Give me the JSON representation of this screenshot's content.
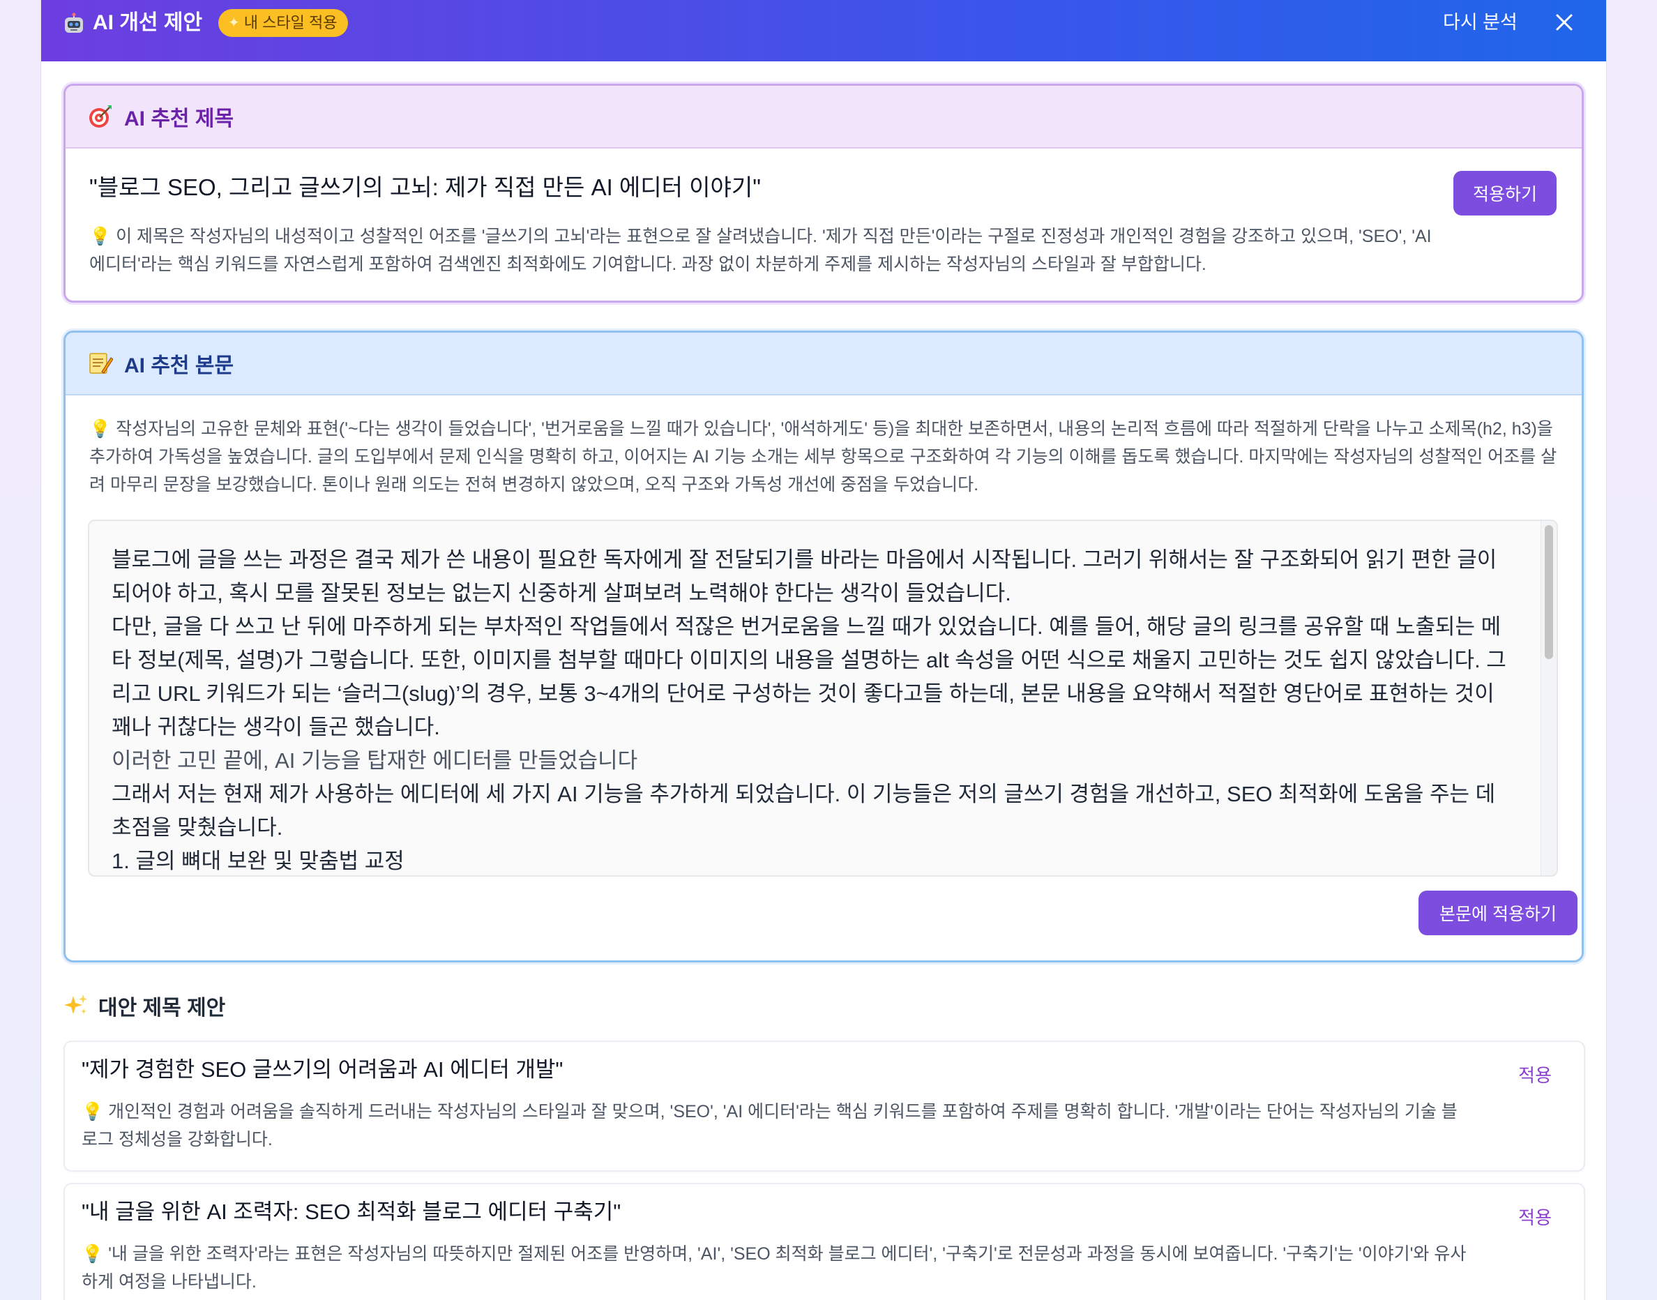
{
  "header": {
    "title": "AI 개선 제안",
    "badge": "내 스타일 적용",
    "reanalyze_label": "다시 분석",
    "icons": [
      "robot-icon",
      "sparkles-icon",
      "close-icon"
    ],
    "gradient": [
      "#6d3ee0",
      "#1f66ea"
    ]
  },
  "title_card": {
    "heading": "AI 추천 제목",
    "icon": "target-icon",
    "recommended_title": "\"블로그 SEO, 그리고 글쓰기의 고뇌: 제가 직접 만든 AI 에디터 이야기\"",
    "reason": "이 제목은 작성자님의 내성적이고 성찰적인 어조를 '글쓰기의 고뇌'라는 표현으로 잘 살려냈습니다. '제가 직접 만든'이라는 구절로 진정성과 개인적인 경험을 강조하고 있으며, 'SEO', 'AI 에디터'라는 핵심 키워드를 자연스럽게 포함하여 검색엔진 최적화에도 기여합니다. 과장 없이 차분하게 주제를 제시하는 작성자님의 스타일과 잘 부합합니다.",
    "apply_label": "적용하기"
  },
  "body_card": {
    "heading": "AI 추천 본문",
    "icon": "memo-icon",
    "reason": "작성자님의 고유한 문체와 표현('~다는 생각이 들었습니다', '번거로움을 느낄 때가 있습니다', '애석하게도' 등)을 최대한 보존하면서, 내용의 논리적 흐름에 따라 적절하게 단락을 나누고 소제목(h2, h3)을 추가하여 가독성을 높였습니다. 글의 도입부에서 문제 인식을 명확히 하고, 이어지는 AI 기능 소개는 세부 항목으로 구조화하여 각 기능의 이해를 돕도록 했습니다. 마지막에는 작성자님의 성찰적인 어조를 살려 마무리 문장을 보강했습니다. 톤이나 원래 의도는 전혀 변경하지 않았으며, 오직 구조와 가독성 개선에 중점을 두었습니다.",
    "paragraphs": [
      "블로그에 글을 쓰는 과정은 결국 제가 쓴 내용이 필요한 독자에게 잘 전달되기를 바라는 마음에서 시작됩니다. 그러기 위해서는 잘 구조화되어 읽기 편한 글이 되어야 하고, 혹시 모를 잘못된 정보는 없는지 신중하게 살펴보려 노력해야 한다는 생각이 들었습니다.",
      "다만, 글을 다 쓰고 난 뒤에 마주하게 되는 부차적인 작업들에서 적잖은 번거로움을 느낄 때가 있었습니다. 예를 들어, 해당 글의 링크를 공유할 때 노출되는 메타 정보(제목, 설명)가 그렇습니다. 또한, 이미지를 첨부할 때마다 이미지의 내용을 설명하는 alt 속성을 어떤 식으로 채울지 고민하는 것도 쉽지 않았습니다. 그리고 URL 키워드가 되는 ‘슬러그(slug)’의 경우, 보통 3~4개의 단어로 구성하는 것이 좋다고들 하는데, 본문 내용을 요약해서 적절한 영단어로 표현하는 것이 꽤나 귀찮다는 생각이 들곤 했습니다.",
      "이러한 고민 끝에, AI 기능을 탑재한 에디터를 만들었습니다",
      "그래서 저는 현재 제가 사용하는 에디터에 세 가지 AI 기능을 추가하게 되었습니다. 이 기능들은 저의 글쓰기 경험을 개선하고, SEO 최적화에 도움을 주는 데 초점을 맞췄습니다.",
      "1. 글의 뼈대 보완 및 맞춤법 교정"
    ],
    "apply_label": "본문에 적용하기"
  },
  "alternatives": {
    "heading": "대안 제목 제안",
    "icon": "sparkles-icon",
    "apply_label": "적용",
    "items": [
      {
        "title": "\"제가 경험한 SEO 글쓰기의 어려움과 AI 에디터 개발\"",
        "reason": "개인적인 경험과 어려움을 솔직하게 드러내는 작성자님의 스타일과 잘 맞으며, 'SEO', 'AI 에디터'라는 핵심 키워드를 포함하여 주제를 명확히 합니다. '개발'이라는 단어는 작성자님의 기술 블로그 정체성을 강화합니다."
      },
      {
        "title": "\"내 글을 위한 AI 조력자: SEO 최적화 블로그 에디터 구축기\"",
        "reason": "'내 글을 위한 조력자'라는 표현은 작성자님의 따뜻하지만 절제된 어조를 반영하며, 'AI', 'SEO 최적화 블로그 에디터', '구축기'로 전문성과 과정을 동시에 보여줍니다. '구축기'는 '이야기'와 유사하게 여정을 나타냅니다."
      }
    ]
  },
  "colors": {
    "accent": "#7c4ddf",
    "title_card_border": "#c9a7ee",
    "body_card_border": "#8fc0f0",
    "badge": "#fbbf24"
  }
}
